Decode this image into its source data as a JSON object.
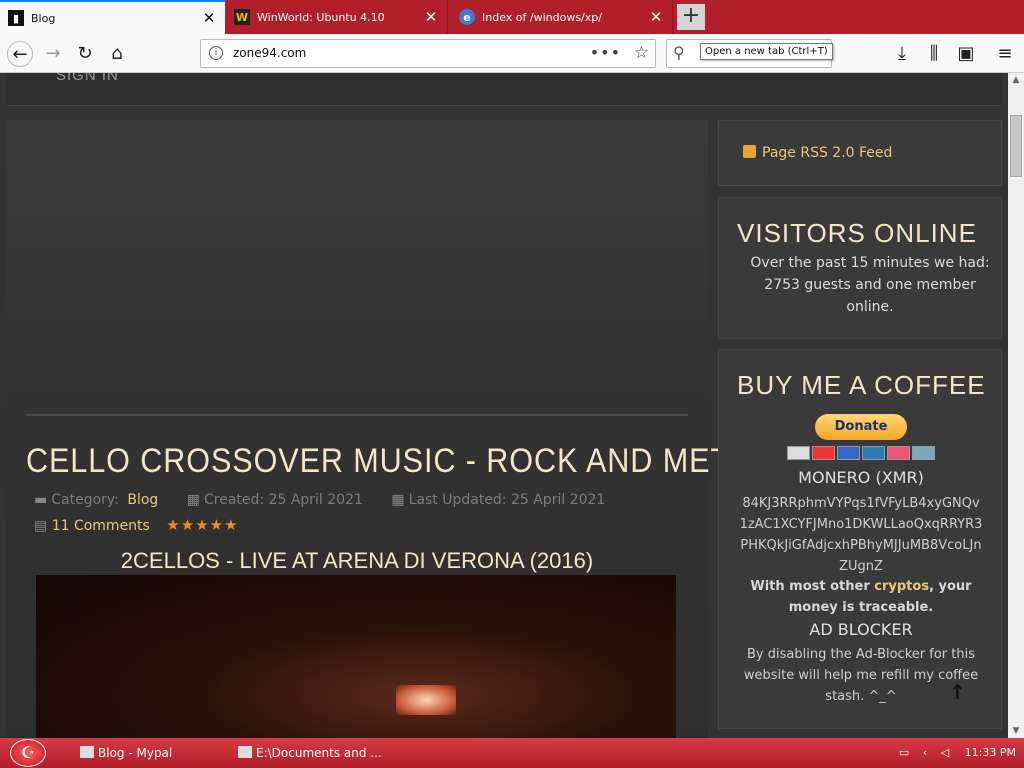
{
  "tabs": [
    {
      "title": "Blog",
      "favicon": "terminal-favicon",
      "close": "✕",
      "active": true
    },
    {
      "title": "WinWorld: Ubuntu 4.10",
      "favicon": "winworld-favicon",
      "close": "✕",
      "active": false
    },
    {
      "title": "Index of /windows/xp/",
      "favicon": "ie-favicon",
      "close": "✕",
      "active": false
    }
  ],
  "newtab": {
    "label": "+",
    "tooltip": "Open a new tab (Ctrl+T)"
  },
  "nav": {
    "back": "←",
    "forward": "→",
    "reload": "↻",
    "home": "⌂",
    "url": "zone94.com",
    "page_actions": "•••",
    "bookmark": "☆",
    "search_icon": "⚲",
    "download": "⤓",
    "library": "⫼",
    "sidebar": "▣",
    "menu": "≡"
  },
  "page": {
    "signin": "SIGN IN",
    "article": {
      "title": "CELLO CROSSOVER MUSIC - ROCK AND METAL",
      "category_label": "Category:",
      "category": "Blog",
      "created": "Created: 25 April 2021",
      "updated": "Last Updated: 25 April 2021",
      "comments": "11 Comments",
      "stars": "★★★★★",
      "subtitle": "2CELLOS - LIVE AT ARENA DI VERONA (2016)"
    },
    "sidebar": {
      "rss": "Page RSS 2.0 Feed",
      "visitors_title": "VISITORS ONLINE",
      "visitors_text": "Over the past 15 minutes we had: 2753 guests and one member online.",
      "coffee_title": "BUY ME A COFFEE",
      "donate": "Donate",
      "monero_title": "MONERO (XMR)",
      "monero_address": "84KJ3RRphmVYPqs1fVFyLB4xyGNQv1zAC1XCYFJMno1DKWLLaoQxqRRYR3PHKQkJiGfAdjcxhPBhyMJJuMB8VcoLJnZUgnZ",
      "warn_pre": "With most other",
      "warn_link": "cryptos",
      "warn_post": ", your money is traceable.",
      "adblock_title": "AD BLOCKER",
      "adblock_text": "By disabling the Ad-Blocker for this website will help me refill my coffee stash. ^_^"
    }
  },
  "taskbar": {
    "tasks": [
      "Blog - Mypal",
      "E:\\Documents and ..."
    ],
    "time": "11:33 PM"
  }
}
